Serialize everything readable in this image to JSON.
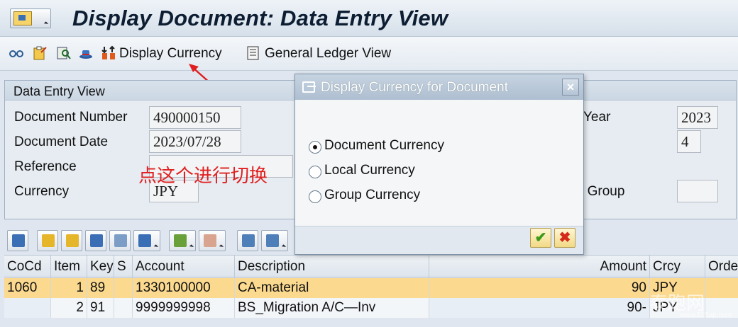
{
  "title": "Display Document: Data Entry View",
  "toolbar": {
    "display_currency": "Display Currency",
    "general_ledger_view": "General Ledger View"
  },
  "annotation": "点这个进行切换",
  "header_section": {
    "title": "Data Entry View",
    "document_number_label": "Document Number",
    "document_number": "490000150",
    "document_date_label": "Document Date",
    "document_date": "2023/07/28",
    "reference_label": "Reference",
    "reference": "",
    "currency_label": "Currency",
    "currency": "JPY",
    "fiscal_year_label": "Year",
    "fiscal_year": "2023",
    "period": "4",
    "group_label": "r Group",
    "group_value": ""
  },
  "dialog": {
    "title": "Display Currency for Document",
    "close_label": "×",
    "options": [
      {
        "label": "Document Currency",
        "selected": true
      },
      {
        "label": "Local Currency",
        "selected": false
      },
      {
        "label": "Group Currency",
        "selected": false
      }
    ],
    "ok_label": "✔",
    "cancel_label": "✖"
  },
  "table": {
    "columns": [
      "CoCd",
      "Item",
      "Key",
      "S",
      "Account",
      "Description",
      "Amount",
      "Crcy",
      "Orde"
    ],
    "rows": [
      [
        "1060",
        "1",
        "89",
        "",
        "1330100000",
        "CA-material",
        "90",
        "JPY",
        ""
      ],
      [
        "",
        "2",
        "91",
        "",
        "9999999998",
        "BS_Migration A/C—Inv",
        "90-",
        "JPY",
        ""
      ]
    ]
  },
  "watermark": "泰跑网",
  "watermark_url": "www.915ap.com",
  "colors": {
    "accent_blue": "#3b6fb5",
    "selected_row": "#fbd98f",
    "annotation_red": "#e02020"
  }
}
